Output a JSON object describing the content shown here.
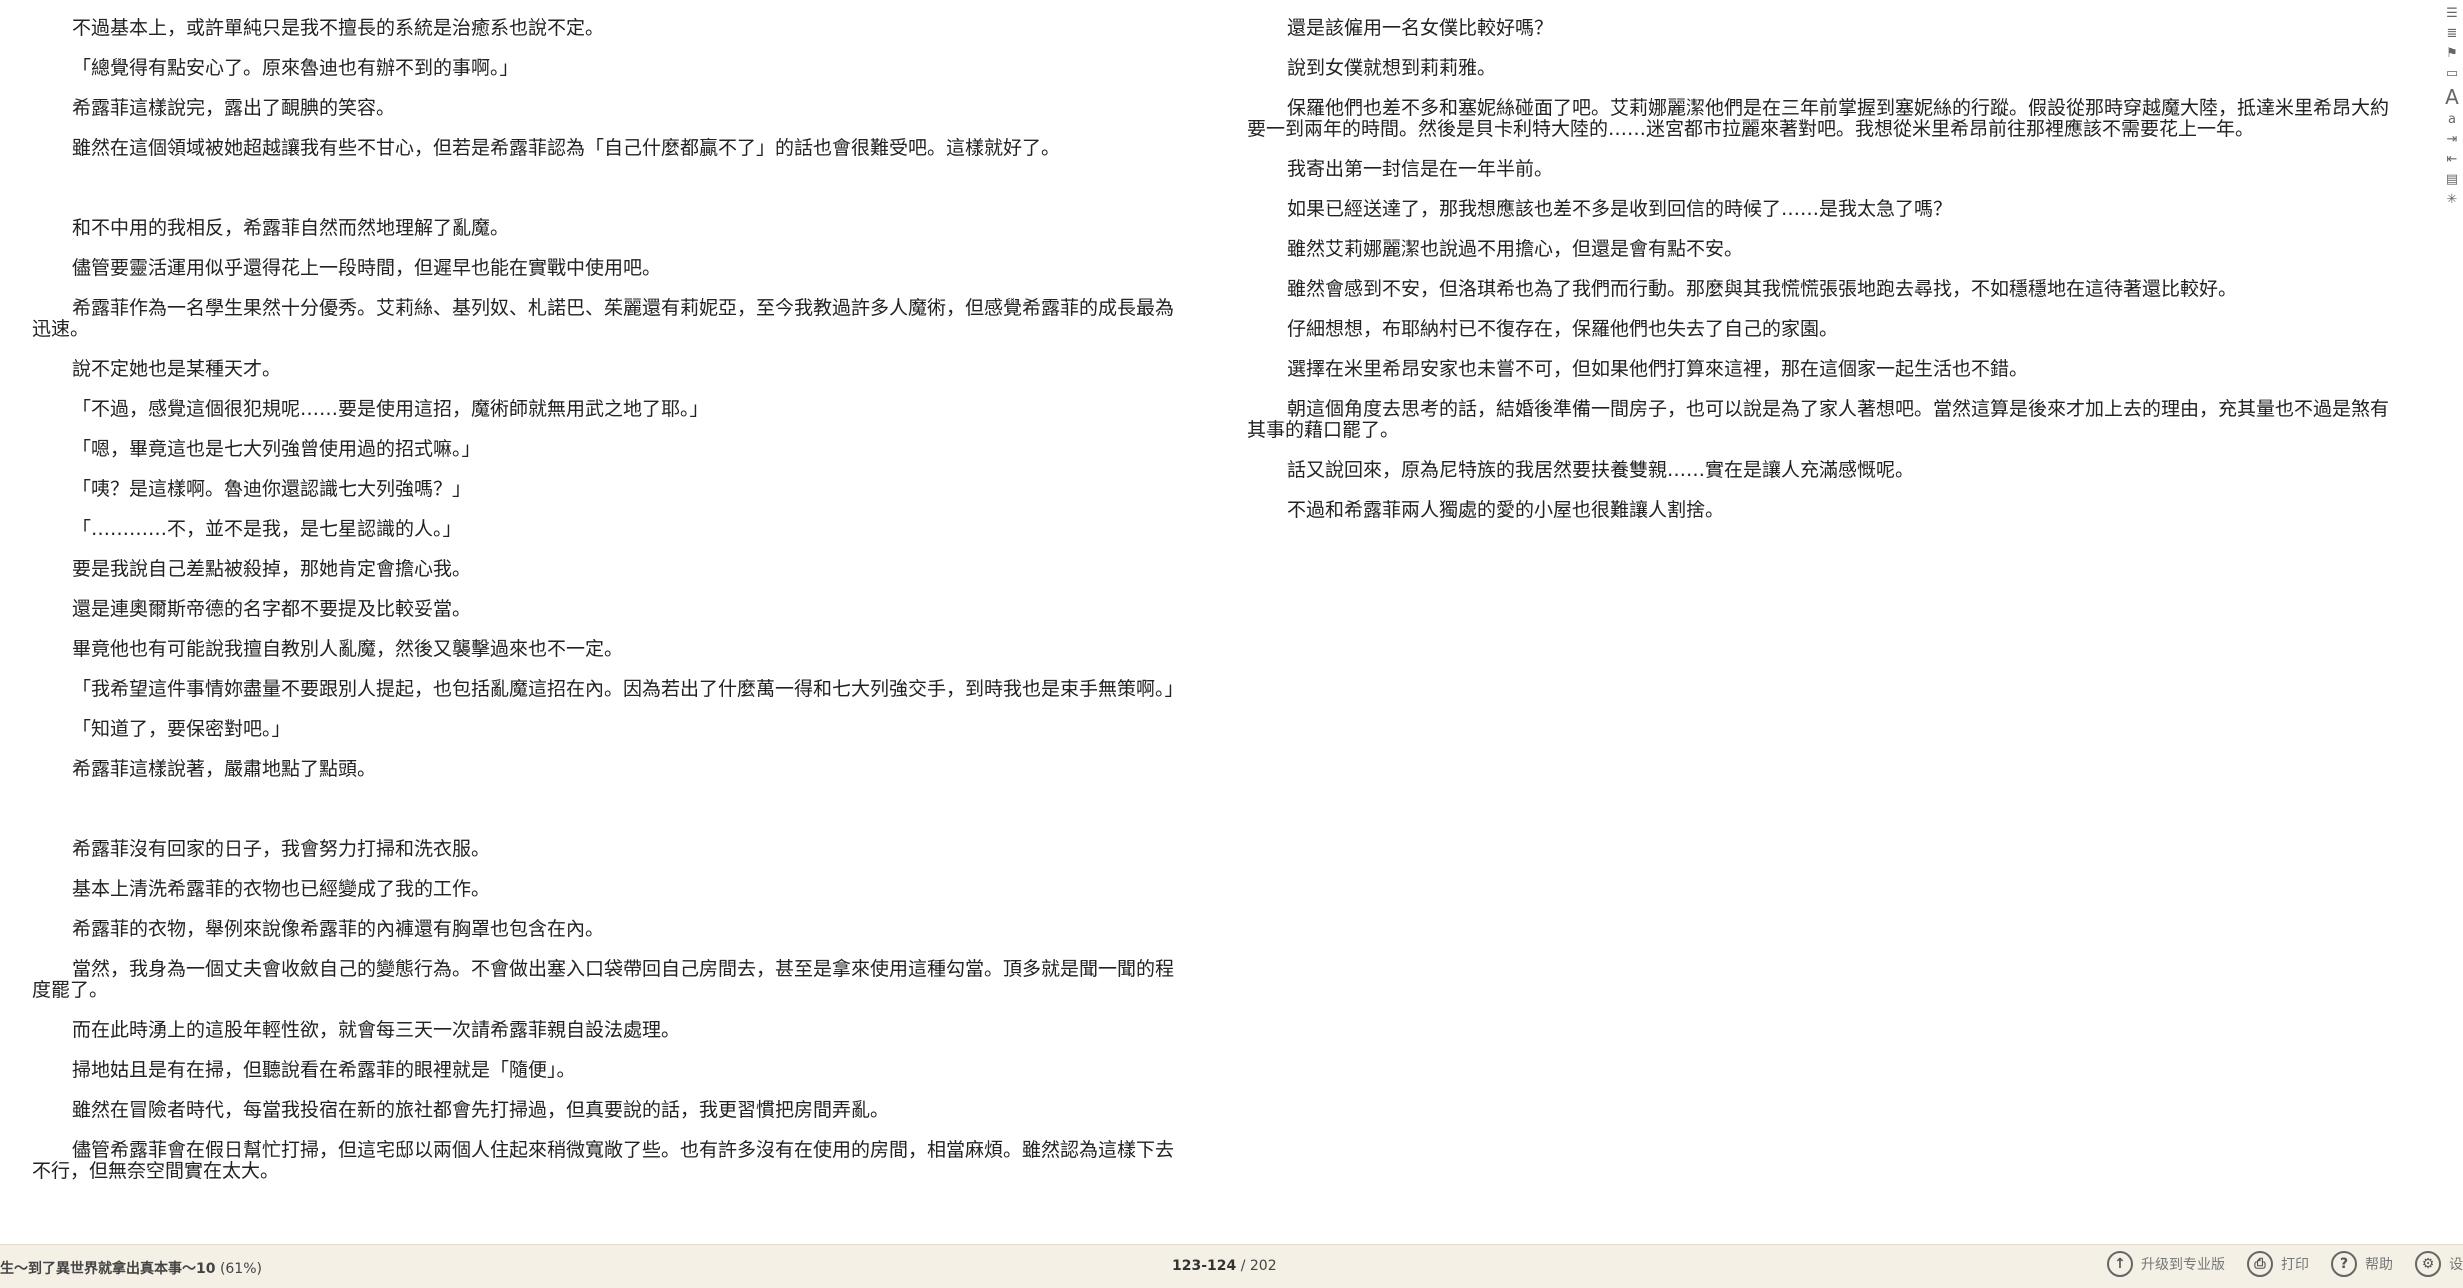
{
  "left_page": {
    "paragraphs": [
      "不過基本上，或許單純只是我不擅長的系統是治癒系也說不定。",
      "「總覺得有點安心了。原來魯迪也有辦不到的事啊。」",
      "希露菲這樣說完，露出了靦腆的笑容。",
      "雖然在這個領域被她超越讓我有些不甘心，但若是希露菲認為「自己什麼都贏不了」的話也會很難受吧。這樣就好了。",
      "",
      "和不中用的我相反，希露菲自然而然地理解了亂魔。",
      "儘管要靈活運用似乎還得花上一段時間，但遲早也能在實戰中使用吧。",
      "希露菲作為一名學生果然十分優秀。艾莉絲、基列奴、札諾巴、茱麗還有莉妮亞，至今我教過許多人魔術，但感覺希露菲的成長最為迅速。",
      "說不定她也是某種天才。",
      "「不過，感覺這個很犯規呢……要是使用這招，魔術師就無用武之地了耶。」",
      "「嗯，畢竟這也是七大列強曾使用過的招式嘛。」",
      "「咦？是這樣啊。魯迪你還認識七大列強嗎？」",
      "「…………不，並不是我，是七星認識的人。」",
      "要是我說自己差點被殺掉，那她肯定會擔心我。",
      "還是連奧爾斯帝德的名字都不要提及比較妥當。",
      "畢竟他也有可能說我擅自教別人亂魔，然後又襲擊過來也不一定。",
      "「我希望這件事情妳盡量不要跟別人提起，也包括亂魔這招在內。因為若出了什麼萬一得和七大列強交手，到時我也是束手無策啊。」",
      "「知道了，要保密對吧。」",
      "希露菲這樣說著，嚴肅地點了點頭。",
      "",
      "希露菲沒有回家的日子，我會努力打掃和洗衣服。",
      "基本上清洗希露菲的衣物也已經變成了我的工作。",
      "希露菲的衣物，舉例來說像希露菲的內褲還有胸罩也包含在內。",
      "當然，我身為一個丈夫會收斂自己的變態行為。不會做出塞入口袋帶回自己房間去，甚至是拿來使用這種勾當。頂多就是聞一聞的程度罷了。",
      "而在此時湧上的這股年輕性欲，就會每三天一次請希露菲親自設法處理。",
      "掃地姑且是有在掃，但聽說看在希露菲的眼裡就是「隨便」。",
      "雖然在冒險者時代，每當我投宿在新的旅社都會先打掃過，但真要說的話，我更習慣把房間弄亂。",
      "儘管希露菲會在假日幫忙打掃，但這宅邸以兩個人住起來稍微寬敞了些。也有許多沒有在使用的房間，相當麻煩。雖然認為這樣下去不行，但無奈空間實在太大。"
    ]
  },
  "right_page": {
    "paragraphs": [
      "還是該僱用一名女僕比較好嗎？",
      "說到女僕就想到莉莉雅。",
      "保羅他們也差不多和塞妮絲碰面了吧。艾莉娜麗潔他們是在三年前掌握到塞妮絲的行蹤。假設從那時穿越魔大陸，抵達米里希昂大約要一到兩年的時間。然後是貝卡利特大陸的……迷宮都市拉麗來著對吧。我想從米里希昂前往那裡應該不需要花上一年。",
      "我寄出第一封信是在一年半前。",
      "如果已經送達了，那我想應該也差不多是收到回信的時候了……是我太急了嗎？",
      "雖然艾莉娜麗潔也說過不用擔心，但還是會有點不安。",
      "雖然會感到不安，但洛琪希也為了我們而行動。那麼與其我慌慌張張地跑去尋找，不如穩穩地在這待著還比較好。",
      "仔細想想，布耶納村已不復存在，保羅他們也失去了自己的家園。",
      "選擇在米里希昂安家也未嘗不可，但如果他們打算來這裡，那在這個家一起生活也不錯。",
      "朝這個角度去思考的話，結婚後準備一間房子，也可以說是為了家人著想吧。當然這算是後來才加上去的理由，充其量也不過是煞有其事的藉口罷了。",
      "話又說回來，原為尼特族的我居然要扶養雙親……實在是讓人充滿感慨呢。",
      "不過和希露菲兩人獨處的愛的小屋也很難讓人割捨。"
    ]
  },
  "statusbar": {
    "book_title": "生～到了異世界就拿出真本事～10",
    "progress": "(61%)",
    "current_pages": "123-124",
    "total_pages": "/ 202",
    "upgrade_label": "升级到专业版",
    "print_label": "打印",
    "help_label": "帮助",
    "settings_label": "设"
  },
  "icons": {
    "upgrade": "arrow-up-circle-icon",
    "print": "printer-icon",
    "help": "question-circle-icon",
    "settings": "gear-icon"
  }
}
